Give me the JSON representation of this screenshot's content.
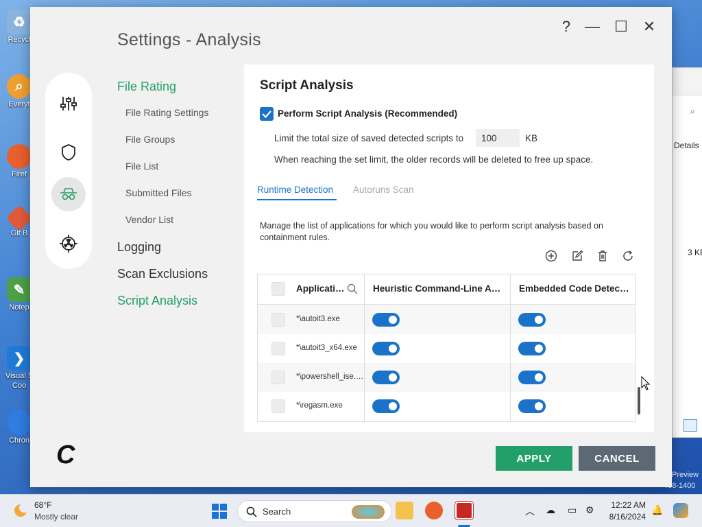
{
  "desktop": {
    "icons": [
      {
        "label": "Recycl",
        "color": "#8ab4e0"
      },
      {
        "label": "Everyt",
        "color": "#f0a030"
      },
      {
        "label": "Firef",
        "color": "#e8602c"
      },
      {
        "label": "Git B",
        "color": "#e05a3a"
      },
      {
        "label": "Notep",
        "color": "#4da04a"
      },
      {
        "label": "Visual S",
        "label2": "Coo",
        "color": "#1f7bd6"
      },
      {
        "label": "Chron",
        "color": "#2f7de0"
      }
    ],
    "bg_window": {
      "details": "Details",
      "size": "3 KE"
    },
    "watermark": {
      "line1": "Preview",
      "line2": "408-1400"
    }
  },
  "window": {
    "title": "Settings - Analysis",
    "controls": {
      "help": "?",
      "minimize": "—",
      "maximize": "☐",
      "close": "✕"
    }
  },
  "nav": {
    "sections": [
      {
        "label": "File Rating",
        "active": true
      },
      {
        "label": "Logging",
        "active": false
      },
      {
        "label": "Scan Exclusions",
        "active": false
      },
      {
        "label": "Script Analysis",
        "active": true
      }
    ],
    "sub_items": [
      "File Rating Settings",
      "File Groups",
      "File List",
      "Submitted Files",
      "Vendor List"
    ]
  },
  "rail_icons": [
    "sliders-icon",
    "shield-icon",
    "spy-icon",
    "radiation-icon"
  ],
  "content": {
    "title": "Script Analysis",
    "perform_label": "Perform Script Analysis (Recommended)",
    "perform_checked": true,
    "limit_label": "Limit the total size of saved detected scripts to",
    "limit_value": "100",
    "limit_unit": "KB",
    "limit_note": "When reaching the set limit, the older records will be deleted to free up space.",
    "tabs": [
      {
        "label": "Runtime Detection",
        "active": true
      },
      {
        "label": "Autoruns Scan",
        "active": false
      }
    ],
    "description_line1": "Manage the list of applications for which you would like to perform script analysis based on",
    "description_line2": "containment rules.",
    "table": {
      "columns": [
        "Applicati…",
        "Heuristic Command-Line A…",
        "Embedded Code Detec…"
      ],
      "rows": [
        {
          "app": "*\\autoit3.exe",
          "heuristic": true,
          "embedded": true
        },
        {
          "app": "*\\autoit3_x64.exe",
          "heuristic": true,
          "embedded": true
        },
        {
          "app": "*\\powershell_ise.…",
          "heuristic": true,
          "embedded": true
        },
        {
          "app": "*\\regasm.exe",
          "heuristic": true,
          "embedded": true
        }
      ]
    }
  },
  "buttons": {
    "apply": "APPLY",
    "cancel": "CANCEL"
  },
  "colors": {
    "accent_green": "#23a06a",
    "accent_blue": "#1a73c9",
    "cancel_gray": "#5c6873"
  },
  "taskbar": {
    "weather_temp": "68°F",
    "weather_desc": "Mostly clear",
    "search_placeholder": "Search",
    "time": "12:22 AM",
    "date": "8/16/2024"
  }
}
